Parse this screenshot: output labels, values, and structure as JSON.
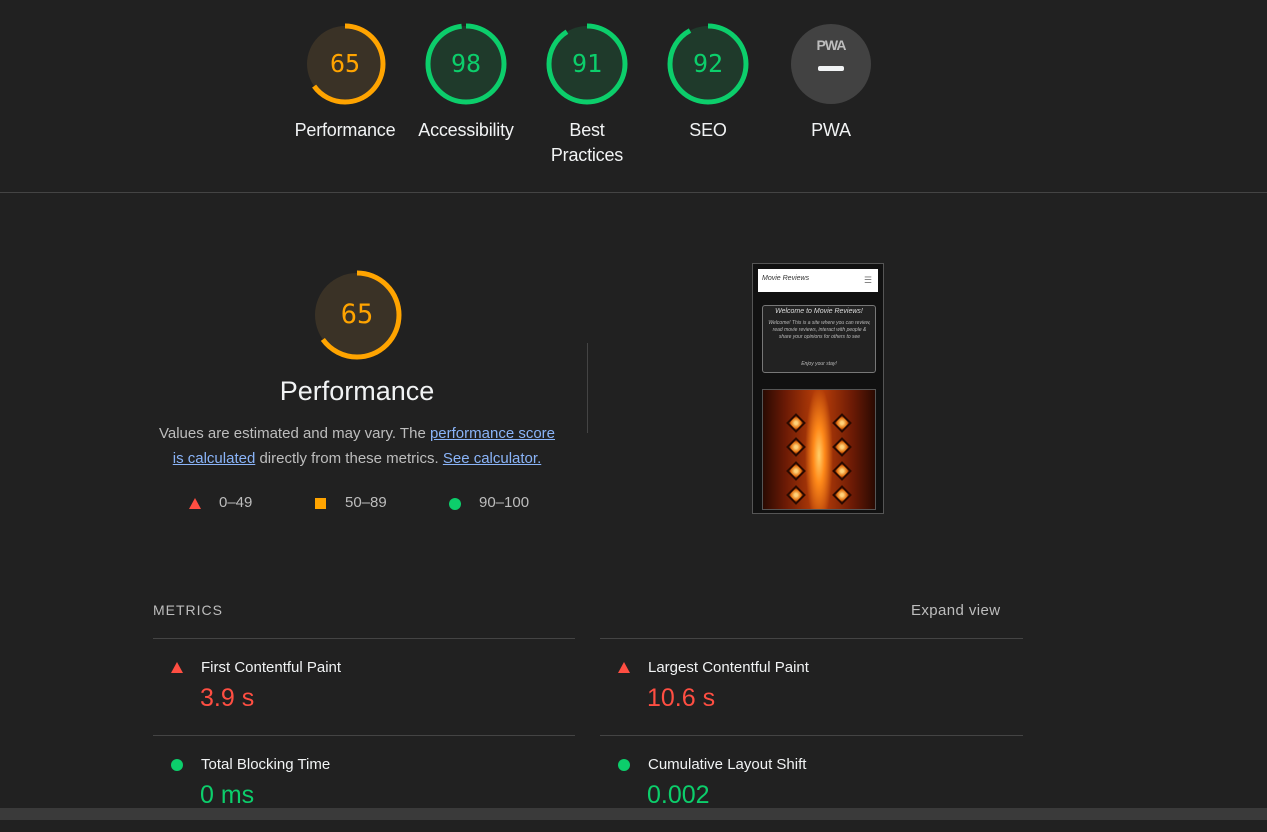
{
  "categories": [
    {
      "id": "performance",
      "score": "65",
      "label": "Performance",
      "status": "average",
      "fraction": 0.65
    },
    {
      "id": "accessibility",
      "score": "98",
      "label": "Accessibility",
      "status": "pass",
      "fraction": 0.98
    },
    {
      "id": "best-practices",
      "score": "91",
      "label": "Best Practices",
      "status": "pass",
      "fraction": 0.91
    },
    {
      "id": "seo",
      "score": "92",
      "label": "SEO",
      "status": "pass",
      "fraction": 0.92
    }
  ],
  "pwa": {
    "badge_text": "PWA",
    "label": "PWA"
  },
  "performance": {
    "score": "65",
    "fraction": 0.65,
    "title": "Performance",
    "desc_prefix": "Values are estimated and may vary. The ",
    "link_score": "performance score is calculated",
    "desc_middle": " directly from these metrics. ",
    "link_calc": "See calculator.",
    "legend": [
      {
        "shape": "triangle",
        "range": "0–49"
      },
      {
        "shape": "square",
        "range": "50–89"
      },
      {
        "shape": "circle",
        "range": "90–100"
      }
    ]
  },
  "screenshot": {
    "nav_brand": "Movie Reviews",
    "nav_icon": "hamburger-icon",
    "card_title": "Welcome to Movie Reviews!",
    "card_body": "Welcome! This is a site where you can review, read movie reviews, interact with people & share your opinions for others to see",
    "card_end": "Enjoy your stay!"
  },
  "metrics": {
    "heading": "METRICS",
    "expand_label": "Expand view",
    "items": [
      {
        "label": "First Contentful Paint",
        "value": "3.9 s",
        "status": "fail"
      },
      {
        "label": "Largest Contentful Paint",
        "value": "10.6 s",
        "status": "fail"
      },
      {
        "label": "Total Blocking Time",
        "value": "0 ms",
        "status": "pass"
      },
      {
        "label": "Cumulative Layout Shift",
        "value": "0.002",
        "status": "pass"
      }
    ]
  },
  "colors": {
    "background": "#212121",
    "average": "#ffa400",
    "pass": "#0cce6b",
    "fail": "#ff4e42",
    "link": "#8ab4f8"
  }
}
